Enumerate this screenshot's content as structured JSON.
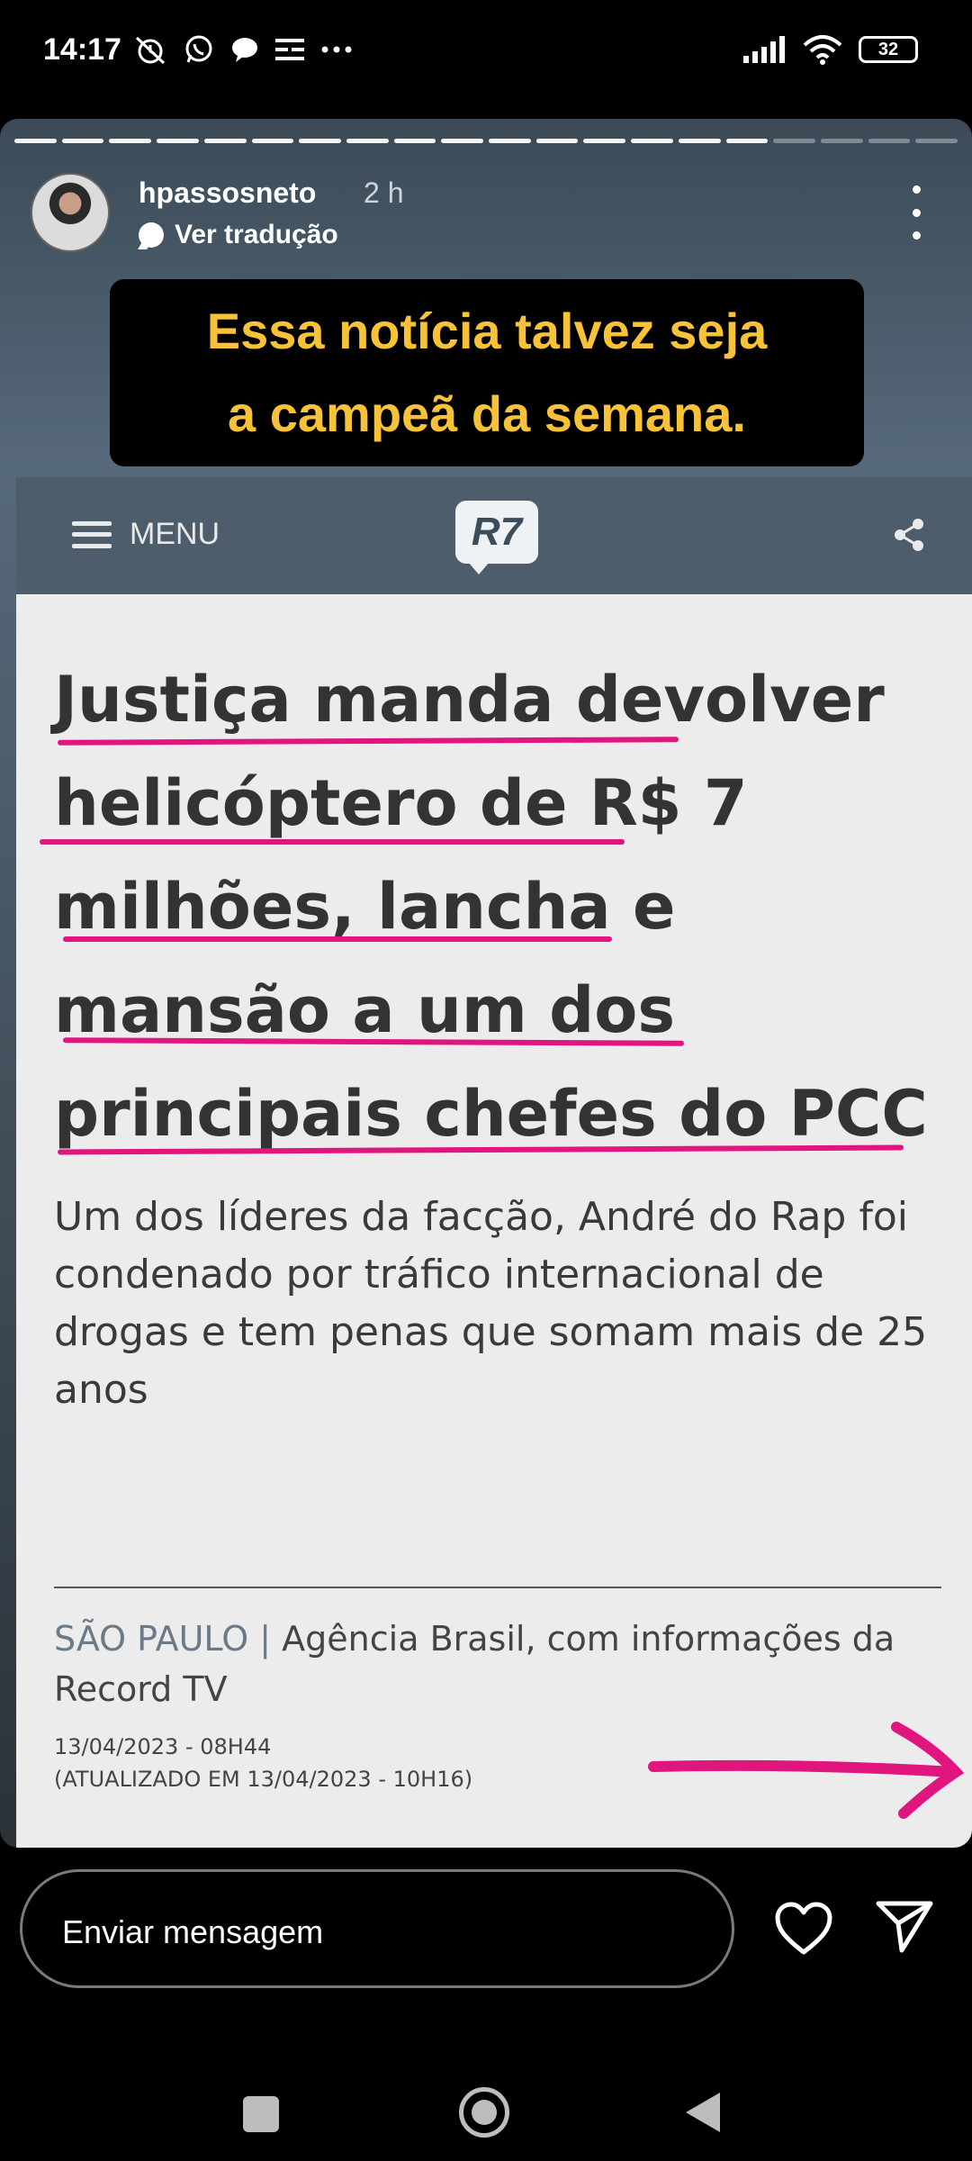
{
  "status_bar": {
    "time": "14:17",
    "battery": "32",
    "left_icons": [
      "alarm-off-icon",
      "whatsapp-icon",
      "chat-bubble-icon",
      "list-icon",
      "more-dots-icon"
    ],
    "right_icons": [
      "signal-icon",
      "wifi-icon",
      "battery-icon"
    ]
  },
  "story": {
    "progress_segments_total": 20,
    "progress_segments_done": 16,
    "username": "hpassosneto",
    "time_ago": "2 h",
    "translate_label": "Ver tradução",
    "caption_lines": [
      "Essa notícia talvez seja",
      "a campeã da semana."
    ]
  },
  "article": {
    "menu_label": "MENU",
    "logo": "R7",
    "headline_lines": [
      "Justiça manda devolver",
      "helicóptero de R$ 7",
      "milhões, lancha e",
      "mansão a um dos",
      "principais chefes do PCC"
    ],
    "subheadline": "Um dos líderes da facção, André do Rap foi condenado por tráfico internacional de drogas e tem penas que somam mais de 25 anos",
    "city": "SÃO PAULO",
    "separator": "|",
    "source": "Agência Brasil, com informações da Record TV",
    "date": "13/04/2023 - 08H44",
    "updated": "(ATUALIZADO EM 13/04/2023 - 10H16)",
    "highlight_color": "#e0157e"
  },
  "footer": {
    "message_placeholder": "Enviar mensagem"
  },
  "colors": {
    "caption_text": "#f7c238",
    "r7_header": "#4e5d6b"
  }
}
